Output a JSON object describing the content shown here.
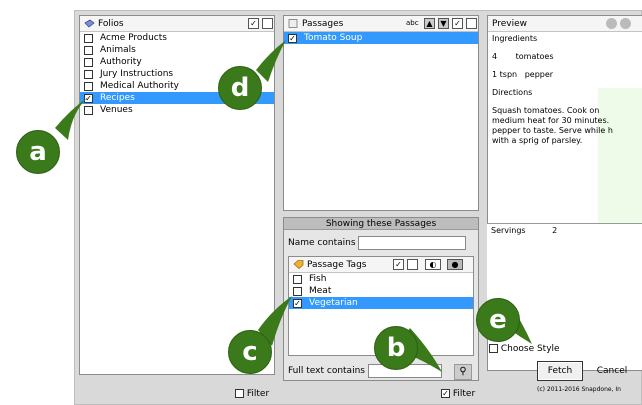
{
  "folios": {
    "title": "Folios",
    "items": [
      {
        "label": "Acme Products",
        "checked": false,
        "selected": false
      },
      {
        "label": "Animals",
        "checked": false,
        "selected": false
      },
      {
        "label": "Authority",
        "checked": false,
        "selected": false
      },
      {
        "label": "Jury Instructions",
        "checked": false,
        "selected": false
      },
      {
        "label": "Medical Authority",
        "checked": false,
        "selected": false
      },
      {
        "label": "Recipes",
        "checked": true,
        "selected": true
      },
      {
        "label": "Venues",
        "checked": false,
        "selected": false
      }
    ],
    "filter_label": "Filter"
  },
  "passages": {
    "title": "Passages",
    "abc": "abc",
    "items": [
      {
        "label": "Tomato Soup",
        "checked": true,
        "selected": true
      }
    ]
  },
  "filter_panel": {
    "title": "Showing these Passages",
    "name_contains_label": "Name contains",
    "passage_tags_label": "Passage Tags",
    "tags": [
      {
        "label": "Fish",
        "checked": false,
        "selected": false
      },
      {
        "label": "Meat",
        "checked": false,
        "selected": false
      },
      {
        "label": "Vegetarian",
        "checked": true,
        "selected": true
      }
    ],
    "full_text_label": "Full text contains",
    "filter_label": "Filter"
  },
  "preview": {
    "title": "Preview",
    "ingredients_heading": "Ingredients",
    "ingredient_1_qty": "4",
    "ingredient_1_name": "tomatoes",
    "ingredient_2": "1 tspn   pepper",
    "directions_heading": "Directions",
    "directions_text": "Squash tomatoes.  Cook on medium heat for 30 minutes. pepper to taste.  Serve while h with a sprig of parsley.",
    "servings_label": "Servings",
    "servings_value": "2",
    "choose_style": "Choose Style"
  },
  "buttons": {
    "fetch": "Fetch",
    "cancel": "Cancel"
  },
  "copyright": "(c) 2011-2016 Snapdone, In",
  "callouts": [
    "a",
    "b",
    "c",
    "d",
    "e"
  ],
  "colors": {
    "selection": "#3399ff",
    "callout": "#3a7a1a",
    "panel_bg": "#d9d9d9"
  }
}
